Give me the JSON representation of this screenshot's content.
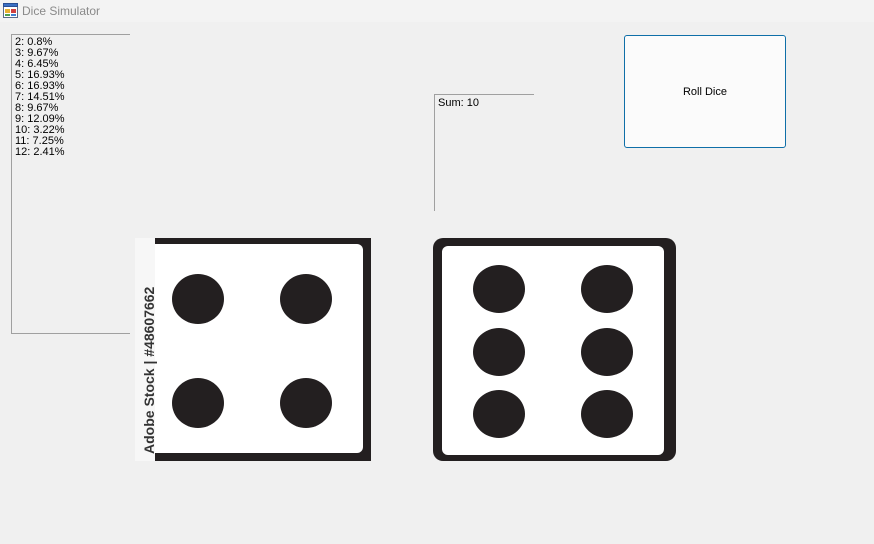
{
  "window": {
    "title": "Dice Simulator"
  },
  "distribution": {
    "items": [
      "2: 0.8%",
      "3: 9.67%",
      "4: 6.45%",
      "5: 16.93%",
      "6: 16.93%",
      "7: 14.51%",
      "8: 9.67%",
      "9: 12.09%",
      "10: 3.22%",
      "11: 7.25%",
      "12: 2.41%"
    ]
  },
  "sum": {
    "text": "Sum: 10"
  },
  "roll_button": {
    "label": "Roll Dice"
  },
  "dice": {
    "left": {
      "value": 4,
      "watermark_text": "Adobe Stock | #48607662"
    },
    "right": {
      "value": 6
    }
  },
  "colors": {
    "button_border": "#0f6fa8",
    "die_frame": "#231f20",
    "pip": "#231f20"
  }
}
